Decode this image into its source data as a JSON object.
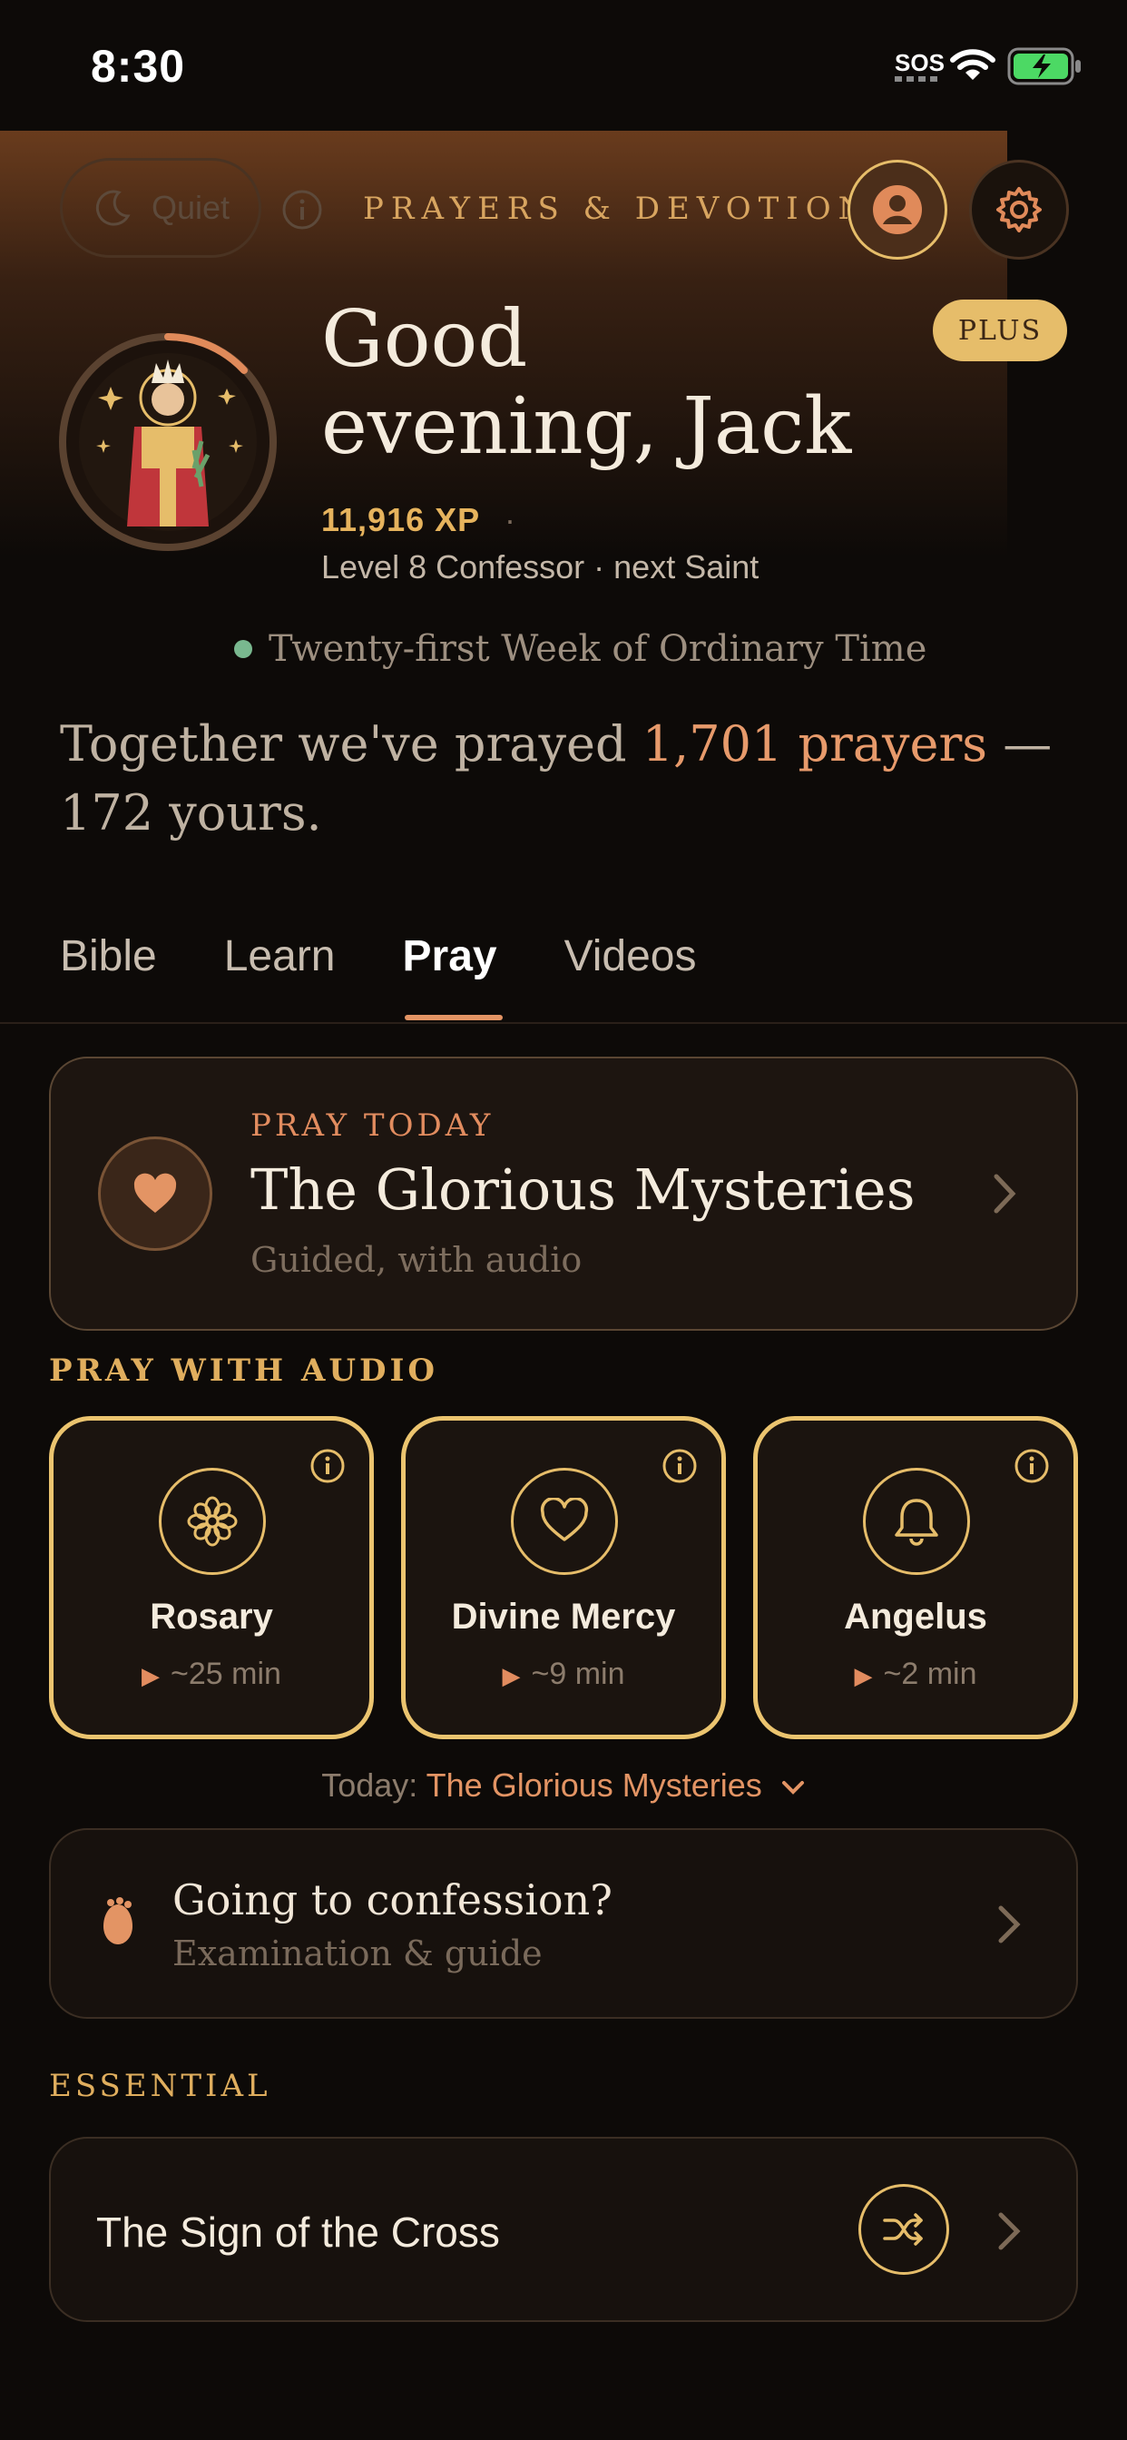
{
  "status_bar": {
    "time": "8:30",
    "sos": "SOS"
  },
  "header": {
    "quiet_label": "Quiet",
    "title": "PRAYERS & DEVOTIONS",
    "plus_badge": "PLUS"
  },
  "profile": {
    "greeting": "Good evening, Jack",
    "xp": "11,916 XP",
    "xp_separator": "·",
    "level": "Level 8 Confessor · next Saint"
  },
  "season": "Twenty-first Week of Ordinary Time",
  "together": {
    "prefix": "Together we've prayed ",
    "count": "1,701 prayers",
    "suffix": " — 172 yours."
  },
  "tabs": [
    {
      "label": "Bible"
    },
    {
      "label": "Learn"
    },
    {
      "label": "Pray",
      "active": true
    },
    {
      "label": "Videos"
    }
  ],
  "pray_today": {
    "kicker": "PRAY TODAY",
    "title": "The Glorious Mysteries",
    "subtitle": "Guided, with audio"
  },
  "pray_with_audio": {
    "label": "PRAY WITH AUDIO",
    "items": [
      {
        "name": "Rosary",
        "duration": "~25 min",
        "icon": "flower-icon"
      },
      {
        "name": "Divine Mercy",
        "duration": "~9 min",
        "icon": "heart-outline-icon"
      },
      {
        "name": "Angelus",
        "duration": "~2 min",
        "icon": "bell-icon"
      }
    ]
  },
  "today_selector": {
    "label": "Today:",
    "value": "The Glorious Mysteries"
  },
  "confession": {
    "title": "Going to confession?",
    "subtitle": "Examination & guide"
  },
  "essential": {
    "label": "ESSENTIAL",
    "item_title": "The Sign of the Cross"
  },
  "colors": {
    "accent_orange": "#e39464",
    "gold": "#e6bd6a",
    "background": "#0d0a08"
  }
}
